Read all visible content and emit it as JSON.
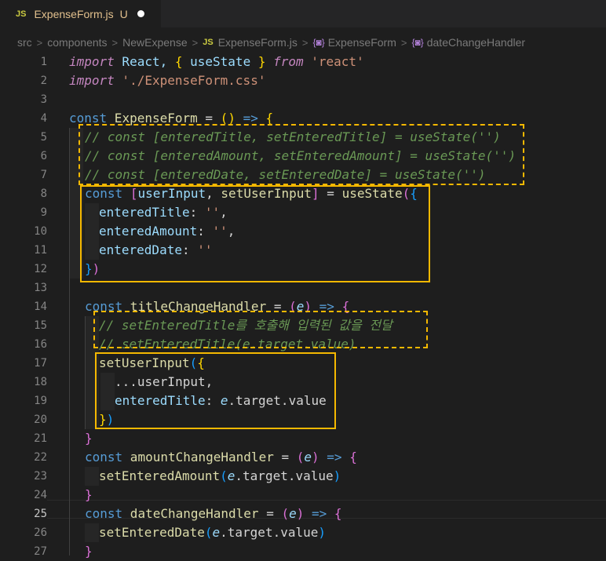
{
  "tab": {
    "badge": "JS",
    "filename": "ExpenseForm.js",
    "status": "U"
  },
  "breadcrumb": [
    "src",
    "components",
    "NewExpense",
    "ExpenseForm.js",
    "ExpenseForm",
    "dateChangeHandler"
  ],
  "breadcrumb_js_badge": "JS",
  "breadcrumb_symbol_icon": "{◙}",
  "line_numbers": [
    "1",
    "2",
    "3",
    "4",
    "5",
    "6",
    "7",
    "8",
    "9",
    "10",
    "11",
    "12",
    "13",
    "14",
    "15",
    "16",
    "17",
    "18",
    "19",
    "20",
    "21",
    "22",
    "23",
    "24",
    "25",
    "26",
    "27"
  ],
  "active_line": "25",
  "tokens": {
    "import": "import",
    "react_id": " React, ",
    "brace_o": "{",
    "useState_id": " useState ",
    "brace_c": "}",
    "from": " from ",
    "react_str": "'react'",
    "css_str": " './ExpenseForm.css'",
    "const": "const",
    "expense_form": " ExpenseForm",
    "assign_arrow": " = ",
    "paren_o": "(",
    "paren_c": ")",
    "arrow": " => ",
    "block_o": "{",
    "c5": "// const [enteredTitle, setEnteredTitle] = useState('')",
    "c6": "// const [enteredAmount, setEnteredAmount] = useState('')",
    "c7": "// const [enteredDate, setEnteredDate] = useState('')",
    "sq_o": "[",
    "user_input": "userInput",
    "comma_sp": ", ",
    "set_user_input": "setUserInput",
    "sq_c": "]",
    "eq": " = ",
    "use_state": "useState",
    "obj_o": "{",
    "entered_title": "enteredTitle",
    "colon_empty_comma": ": '',",
    "entered_amount": "enteredAmount",
    "entered_date": "enteredDate",
    "colon_empty": ": ''",
    "obj_c": "}",
    "call_c": ")",
    "title_handler": " titleChangeHandler",
    "e": "e",
    "c15": "// setEnteredTitle를 호출해 입력된 값을 전달",
    "c16": "// setEnteredTitle(e.target.value)",
    "spread": "...userInput,",
    "colon_sp": ": ",
    "target_value": ".target.value",
    "block_c": "}",
    "amount_handler": " amountChangeHandler",
    "set_entered_amount": "setEnteredAmount",
    "date_handler": " dateChangeHandler",
    "set_entered_date": "setEnteredDate"
  },
  "colors": {
    "highlight_box": "#f5b800",
    "comment": "#6a9955",
    "keyword": "#569cd6",
    "string": "#ce9178"
  }
}
